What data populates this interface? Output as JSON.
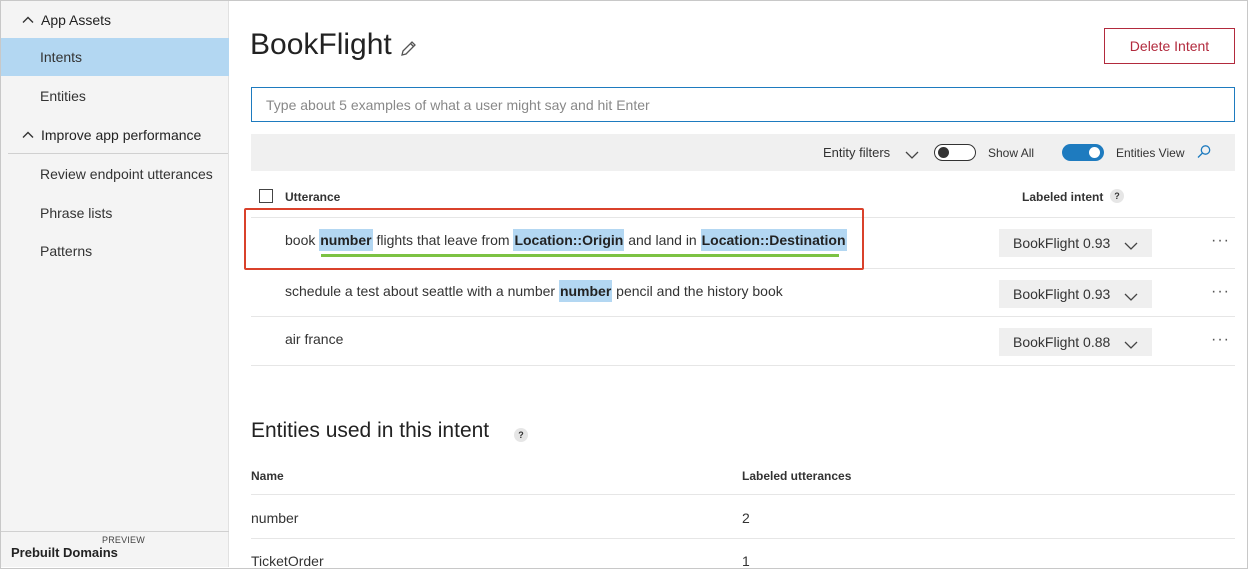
{
  "sidebar": {
    "section1": "App Assets",
    "items1": [
      "Intents",
      "Entities"
    ],
    "section2": "Improve app performance",
    "items2": [
      "Review endpoint utterances",
      "Phrase lists",
      "Patterns"
    ],
    "bottom_badge": "PREVIEW",
    "bottom_label": "Prebuilt Domains"
  },
  "header": {
    "title": "BookFlight",
    "delete_label": "Delete Intent"
  },
  "input": {
    "placeholder": "Type about 5 examples of what a user might say and hit Enter"
  },
  "filterbar": {
    "entity_filters": "Entity filters",
    "show_all": "Show All",
    "show_all_on": false,
    "entities_view": "Entities View",
    "entities_view_on": true
  },
  "table": {
    "col_utterance": "Utterance",
    "col_intent": "Labeled intent",
    "help": "?",
    "rows": [
      {
        "parts": [
          "book ",
          "number",
          " flights that leave from ",
          "Location::Origin",
          " and land in ",
          "Location::Destination"
        ],
        "intent": "BookFlight 0.93"
      },
      {
        "parts": [
          "schedule a test about seattle with a number ",
          "number",
          " pencil and the history book"
        ],
        "intent": "BookFlight 0.93"
      },
      {
        "parts": [
          "air france"
        ],
        "intent": "BookFlight 0.88"
      }
    ]
  },
  "entities_section": {
    "title": "Entities used in this intent",
    "help": "?",
    "col_name": "Name",
    "col_count": "Labeled utterances",
    "rows": [
      {
        "name": "number",
        "count": "2"
      },
      {
        "name": "TicketOrder",
        "count": "1"
      }
    ]
  },
  "colors": {
    "accent": "#1e7bbf",
    "delete": "#b22a3d",
    "entity_highlight": "#b3d7f2",
    "underline_green": "#7cc243",
    "callout_red": "#d9412b"
  }
}
